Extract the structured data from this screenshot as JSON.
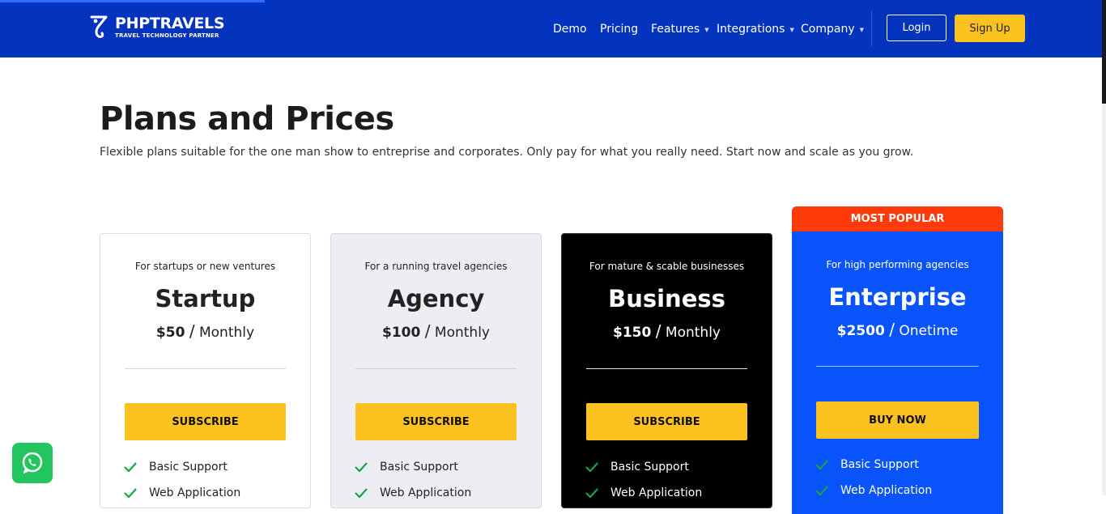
{
  "nav": {
    "logo_name": "PHPTRAVELS",
    "logo_tagline": "TRAVEL TECHNOLOGY PARTNER",
    "items": [
      {
        "label": "Demo"
      },
      {
        "label": "Pricing"
      },
      {
        "label": "Features"
      },
      {
        "label": "Integrations"
      },
      {
        "label": "Company"
      }
    ],
    "login": "Login",
    "signup": "Sign Up"
  },
  "page": {
    "title": "Plans and Prices",
    "subtitle": "Flexible plans suitable for the one man show to entreprise and corporates. Only pay for what you really need. Start now and scale as you grow."
  },
  "plans": [
    {
      "for": "For startups or new ventures",
      "name": "Startup",
      "price": "$50",
      "period": "Monthly",
      "cta": "SUBSCRIBE",
      "features": [
        "Basic Support",
        "Web Application"
      ]
    },
    {
      "for": "For a running travel agencies",
      "name": "Agency",
      "price": "$100",
      "period": "Monthly",
      "cta": "SUBSCRIBE",
      "features": [
        "Basic Support",
        "Web Application"
      ]
    },
    {
      "for": "For mature & scable businesses",
      "name": "Business",
      "price": "$150",
      "period": "Monthly",
      "cta": "SUBSCRIBE",
      "features": [
        "Basic Support",
        "Web Application"
      ]
    },
    {
      "for": "For high performing agencies",
      "name": "Enterprise",
      "price": "$2500",
      "period": "Onetime",
      "cta": "BUY NOW",
      "badge": "MOST POPULAR",
      "features": [
        "Basic Support",
        "Web Application"
      ]
    }
  ],
  "colors": {
    "nav_bg": "#0434bd",
    "accent_yellow": "#fcc21f",
    "popular_red": "#ff3a0b",
    "enterprise_blue": "#0954fa",
    "check_green": "#16a34a"
  },
  "icons": {
    "whatsapp": "whatsapp-icon",
    "check": "check-icon",
    "caret": "chevron-down-icon"
  }
}
